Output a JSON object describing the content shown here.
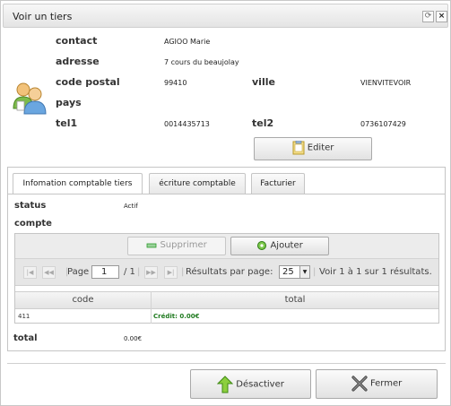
{
  "window": {
    "title": "Voir un tiers"
  },
  "fields": {
    "contact_label": "contact",
    "contact_value": "AGIOO Marie",
    "adresse_label": "adresse",
    "adresse_value": "7 cours du beaujolay",
    "code_postal_label": "code postal",
    "code_postal_value": "99410",
    "ville_label": "ville",
    "ville_value": "VIENVITEVOIR",
    "pays_label": "pays",
    "tel1_label": "tel1",
    "tel1_value": "0014435713",
    "tel2_label": "tel2",
    "tel2_value": "0736107429"
  },
  "buttons": {
    "editer": "Editer",
    "desactiver": "Désactiver",
    "fermer": "Fermer"
  },
  "tabs": [
    {
      "label": "Infomation comptable tiers",
      "active": true
    },
    {
      "label": "écriture comptable",
      "active": false
    },
    {
      "label": "Facturier",
      "active": false
    }
  ],
  "account": {
    "status_label": "status",
    "status_value": "Actif",
    "compte_label": "compte",
    "total_label": "total",
    "total_value": "0.00€"
  },
  "grid": {
    "supprimer": "Supprimer",
    "ajouter": "Ajouter",
    "page_label": "Page",
    "page_value": "1",
    "page_total": "/ 1",
    "results_per_page_label": "Résultats par page:",
    "results_per_page_value": "25",
    "results_info": "Voir 1 à 1 sur 1 résultats.",
    "columns": [
      "code",
      "total"
    ],
    "rows": [
      {
        "code": "411",
        "total": "Crédit: 0.00€"
      }
    ]
  },
  "colors": {
    "credit_green": "#1f7a1f",
    "supprimer_icon_green": "#2e9b2e"
  },
  "icons": {
    "avatar": "users-icon",
    "editer": "edit-icon",
    "desactiver": "arrow-up-green-icon",
    "fermer": "close-x-icon",
    "ajouter": "add-gear-icon",
    "supprimer": "minus-icon"
  }
}
